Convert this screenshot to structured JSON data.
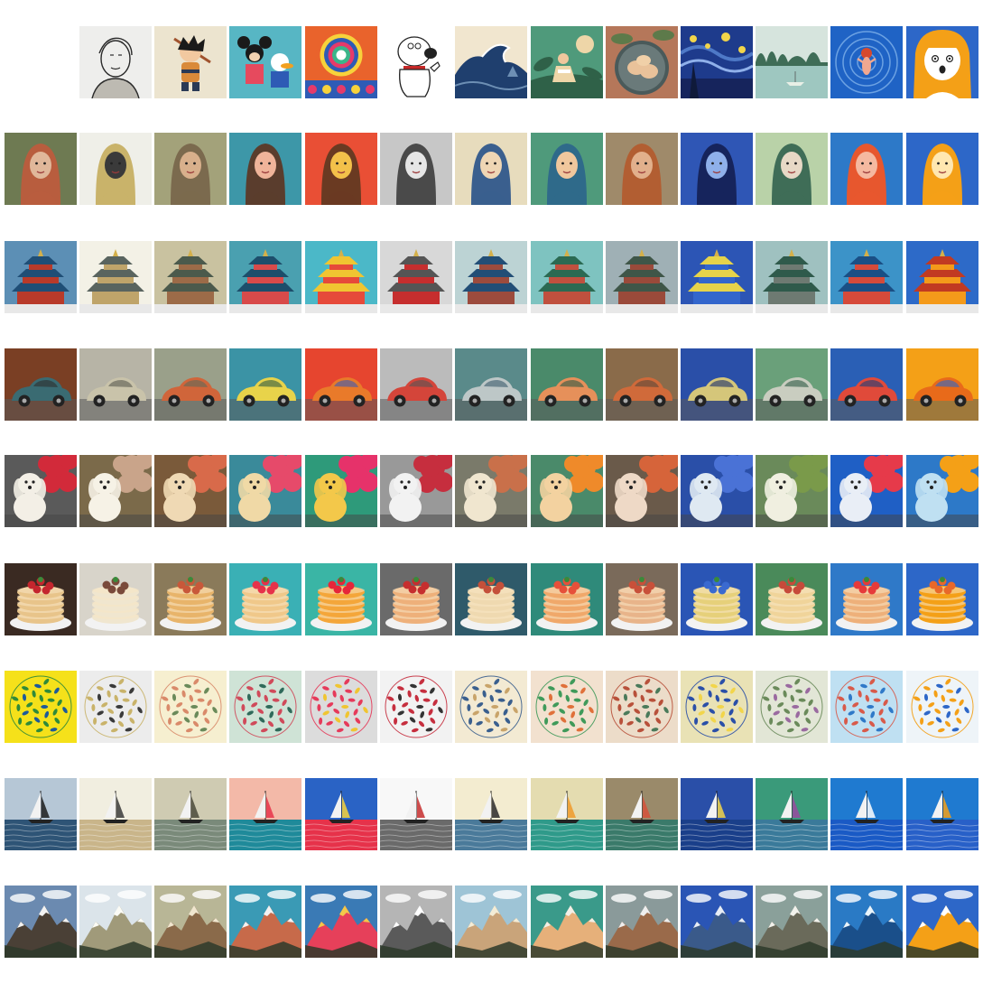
{
  "grid": {
    "style_refs": [
      {
        "name": "pencil-portrait-sketch",
        "bg": "#eeeeec",
        "ink": "#2a2a2a",
        "accent": "#bdbab2"
      },
      {
        "name": "cartoon-monkey-boy",
        "bg": "#ece4cf",
        "ink": "#2b3a55",
        "accent": "#d98a3a"
      },
      {
        "name": "mickey-and-donald-cartoon",
        "bg": "#57b6c4",
        "ink": "#1a1a1a",
        "accent": "#e64a5e"
      },
      {
        "name": "psychedelic-folk-art",
        "bg": "#e9632c",
        "ink": "#2e5bb5",
        "accent": "#f7d23b"
      },
      {
        "name": "cartoon-dog-thumbs-up",
        "bg": "#ffffff",
        "ink": "#222222",
        "accent": "#c62828"
      },
      {
        "name": "great-wave-woodblock",
        "bg": "#f1e6cf",
        "ink": "#1f3f6e",
        "accent": "#6d8fb4"
      },
      {
        "name": "flat-illustration-reader",
        "bg": "#4f9a7b",
        "ink": "#eed6a8",
        "accent": "#2f6148"
      },
      {
        "name": "dumplings-painting",
        "bg": "#b5775a",
        "ink": "#e9c29a",
        "accent": "#5d7a4a"
      },
      {
        "name": "starry-night-painting",
        "bg": "#1e3b8c",
        "ink": "#f2d54a",
        "accent": "#4e79c7"
      },
      {
        "name": "lake-watercolor",
        "bg": "#9ec7c0",
        "ink": "#3f6d57",
        "accent": "#e8efe6"
      },
      {
        "name": "swimmer-blue-water",
        "bg": "#1f63c5",
        "ink": "#d6492e",
        "accent": "#7fb1ea"
      },
      {
        "name": "orange-hair-cartoon-girl",
        "bg": "#2d67c8",
        "ink": "#f4a017",
        "accent": "#ffffff"
      }
    ],
    "rows": [
      {
        "name": "portrait-woman",
        "subject": "portrait",
        "content": {
          "bg": "#6e7a52",
          "main": "#b85d3e",
          "detail": "#e0b79a"
        },
        "styled": [
          {
            "bg": "#efefe8",
            "main": "#c9b36a",
            "detail": "#3a3a3a"
          },
          {
            "bg": "#a3a27a",
            "main": "#7b6a4e",
            "detail": "#d8b08c"
          },
          {
            "bg": "#3d97a8",
            "main": "#5a3d2d",
            "detail": "#f0b49a"
          },
          {
            "bg": "#e94f35",
            "main": "#6a3a22",
            "detail": "#f3c14a"
          },
          {
            "bg": "#c7c7c7",
            "main": "#4a4a4a",
            "detail": "#e6e6e6"
          },
          {
            "bg": "#e7dcbd",
            "main": "#3a5f8e",
            "detail": "#efd6b4"
          },
          {
            "bg": "#4f9a7b",
            "main": "#2f6a8a",
            "detail": "#f0c79d"
          },
          {
            "bg": "#9f8a6a",
            "main": "#b25e32",
            "detail": "#e2b08c"
          },
          {
            "bg": "#2f56b5",
            "main": "#16245c",
            "detail": "#8fb0ea"
          },
          {
            "bg": "#b9d2a8",
            "main": "#3f6d57",
            "detail": "#e7d9c6"
          },
          {
            "bg": "#2d79c8",
            "main": "#e7572e",
            "detail": "#f5b9a0"
          },
          {
            "bg": "#2d67c8",
            "main": "#f4a017",
            "detail": "#ffe7b0"
          }
        ]
      },
      {
        "name": "temple-of-heaven",
        "subject": "temple",
        "content": {
          "bg": "#5c8fb5",
          "main": "#b83a2a",
          "detail": "#1f4e76"
        },
        "styled": [
          {
            "bg": "#f3f1e6",
            "main": "#bfa46a",
            "detail": "#59645f"
          },
          {
            "bg": "#c9c2a0",
            "main": "#9c6b48",
            "detail": "#4b5a4c"
          },
          {
            "bg": "#4aa0b0",
            "main": "#d84a4a",
            "detail": "#1d4e6b"
          },
          {
            "bg": "#4bb8c8",
            "main": "#e64a3a",
            "detail": "#f0c531"
          },
          {
            "bg": "#d8d8d8",
            "main": "#c62e2e",
            "detail": "#555555"
          },
          {
            "bg": "#bcd3d4",
            "main": "#9c4b3d",
            "detail": "#224e76"
          },
          {
            "bg": "#7ec3c0",
            "main": "#c0503e",
            "detail": "#2b6a52"
          },
          {
            "bg": "#9fb0b5",
            "main": "#9a4a3a",
            "detail": "#3f5648"
          },
          {
            "bg": "#2c55b5",
            "main": "#3366cc",
            "detail": "#e6d34a"
          },
          {
            "bg": "#9fc1c0",
            "main": "#6e7a72",
            "detail": "#2f5a4b"
          },
          {
            "bg": "#3c93c8",
            "main": "#d64a3a",
            "detail": "#1a4f85"
          },
          {
            "bg": "#2d6ac8",
            "main": "#f49a1a",
            "detail": "#c13a22"
          }
        ]
      },
      {
        "name": "vintage-car",
        "subject": "car",
        "content": {
          "bg": "#7a3f24",
          "main": "#3a6b72",
          "detail": "#2d2d2d"
        },
        "styled": [
          {
            "bg": "#b7b4a6",
            "main": "#c9c3aa",
            "detail": "#5a5a50"
          },
          {
            "bg": "#9aa08a",
            "main": "#d0653a",
            "detail": "#5f6b5a"
          },
          {
            "bg": "#3b93a5",
            "main": "#e8d34a",
            "detail": "#2e5b44"
          },
          {
            "bg": "#e6452f",
            "main": "#e97a2a",
            "detail": "#3c5ab5"
          },
          {
            "bg": "#bbbbbb",
            "main": "#d4453a",
            "detail": "#555555"
          },
          {
            "bg": "#5a8a8a",
            "main": "#bdc7c7",
            "detail": "#3a5a6a"
          },
          {
            "bg": "#4a8a6a",
            "main": "#e6905a",
            "detail": "#2e5a44"
          },
          {
            "bg": "#8a6b4a",
            "main": "#d06a3a",
            "detail": "#5a4a3a"
          },
          {
            "bg": "#2a4fa8",
            "main": "#d5c67a",
            "detail": "#1a2f6a"
          },
          {
            "bg": "#6aa07a",
            "main": "#c9cdc0",
            "detail": "#2e5a44"
          },
          {
            "bg": "#2a5fb5",
            "main": "#e04a3a",
            "detail": "#1a3f7a"
          },
          {
            "bg": "#f4a017",
            "main": "#e86a1a",
            "detail": "#2d67c8"
          }
        ]
      },
      {
        "name": "spaniel-with-flowers",
        "subject": "dog",
        "content": {
          "bg": "#5a5a5a",
          "main": "#f3efe6",
          "detail": "#d22a3a"
        },
        "styled": [
          {
            "bg": "#7b6a4a",
            "main": "#f6f2e6",
            "detail": "#c9a48a"
          },
          {
            "bg": "#7a5a3a",
            "main": "#efd9b4",
            "detail": "#d86a4a"
          },
          {
            "bg": "#3a8a9a",
            "main": "#f0d9a6",
            "detail": "#e64a6a"
          },
          {
            "bg": "#2e9a7a",
            "main": "#f3c84a",
            "detail": "#e6326a"
          },
          {
            "bg": "#999999",
            "main": "#f2f2f2",
            "detail": "#c62e3e"
          },
          {
            "bg": "#7a7a6a",
            "main": "#f0e6cf",
            "detail": "#c9704a"
          },
          {
            "bg": "#4a8a6a",
            "main": "#f3d2a0",
            "detail": "#ef8a2a"
          },
          {
            "bg": "#6a5a4a",
            "main": "#eed9c6",
            "detail": "#d6643a"
          },
          {
            "bg": "#2a4fa8",
            "main": "#dfe9f2",
            "detail": "#4a72d6"
          },
          {
            "bg": "#6a8a5a",
            "main": "#f0efe0",
            "detail": "#7a9a4a"
          },
          {
            "bg": "#1f5fc5",
            "main": "#e9eef6",
            "detail": "#e63a4a"
          },
          {
            "bg": "#2d79c8",
            "main": "#bfe0f2",
            "detail": "#f4a017"
          }
        ]
      },
      {
        "name": "strawberry-pancakes",
        "subject": "pancakes",
        "content": {
          "bg": "#3a2a22",
          "main": "#e8c48a",
          "detail": "#c4262e"
        },
        "styled": [
          {
            "bg": "#d8d4ca",
            "main": "#f0e6cf",
            "detail": "#7a4a3a"
          },
          {
            "bg": "#8a7a5a",
            "main": "#e8b46a",
            "detail": "#c8583a"
          },
          {
            "bg": "#3ab0b5",
            "main": "#f0c88a",
            "detail": "#e6324a"
          },
          {
            "bg": "#3ab5a5",
            "main": "#f4a63a",
            "detail": "#e6263a"
          },
          {
            "bg": "#6a6a6a",
            "main": "#eeb07a",
            "detail": "#c62e2e"
          },
          {
            "bg": "#2f5a6a",
            "main": "#efd9b0",
            "detail": "#c4503a"
          },
          {
            "bg": "#2f8a7a",
            "main": "#f0a86a",
            "detail": "#e6503a"
          },
          {
            "bg": "#7a6a5a",
            "main": "#e8b48a",
            "detail": "#c8503a"
          },
          {
            "bg": "#2a55b5",
            "main": "#e6d07a",
            "detail": "#3a6ad0"
          },
          {
            "bg": "#4a8a5a",
            "main": "#f0d49a",
            "detail": "#c64a3a"
          },
          {
            "bg": "#2f79c8",
            "main": "#eeb07a",
            "detail": "#e63a3a"
          },
          {
            "bg": "#2d67c8",
            "main": "#f4a017",
            "detail": "#e8682a"
          }
        ]
      },
      {
        "name": "floral-circle-pattern",
        "subject": "pattern",
        "content": {
          "bg": "#f5e11a",
          "main": "#2f8a3a",
          "detail": "#1d5a9a"
        },
        "styled": [
          {
            "bg": "#ececec",
            "main": "#c9b36a",
            "detail": "#3a3a3a"
          },
          {
            "bg": "#f6efd0",
            "main": "#d98a6a",
            "detail": "#6a8a5a"
          },
          {
            "bg": "#cfe3d6",
            "main": "#d04a5a",
            "detail": "#2f6a5a"
          },
          {
            "bg": "#dcdcdc",
            "main": "#e63a5a",
            "detail": "#f0c531"
          },
          {
            "bg": "#f2f2f2",
            "main": "#c62e3e",
            "detail": "#333333"
          },
          {
            "bg": "#f3ead3",
            "main": "#3a5f8e",
            "detail": "#c9a46a"
          },
          {
            "bg": "#f2e1cf",
            "main": "#3f9a5a",
            "detail": "#e0703a"
          },
          {
            "bg": "#ecdcc9",
            "main": "#b8503a",
            "detail": "#4a7a5a"
          },
          {
            "bg": "#e9e2b5",
            "main": "#2a4fa8",
            "detail": "#f2d54a"
          },
          {
            "bg": "#e2e6d6",
            "main": "#6a8a5a",
            "detail": "#9a6aa0"
          },
          {
            "bg": "#bfe0f2",
            "main": "#d85a4a",
            "detail": "#2f79c8"
          },
          {
            "bg": "#eef4f8",
            "main": "#f4a017",
            "detail": "#2d67c8"
          }
        ]
      },
      {
        "name": "sailboat-sea",
        "subject": "sailboat",
        "content": {
          "bg": "#b6c7d6",
          "main": "#2e5476",
          "detail": "#1c1c1c"
        },
        "styled": [
          {
            "bg": "#f1eee0",
            "main": "#c9b58a",
            "detail": "#3a3a3a"
          },
          {
            "bg": "#cfcbb2",
            "main": "#7a8a7a",
            "detail": "#4a4a3a"
          },
          {
            "bg": "#f3b9a8",
            "main": "#1f8a9a",
            "detail": "#e6324a"
          },
          {
            "bg": "#2a63c5",
            "main": "#e6324a",
            "detail": "#f7d23b"
          },
          {
            "bg": "#f8f8f8",
            "main": "#6a6a6a",
            "detail": "#c62e2e"
          },
          {
            "bg": "#f3ecd0",
            "main": "#4a7a9a",
            "detail": "#2a2a2a"
          },
          {
            "bg": "#e4dcb0",
            "main": "#2f9a8a",
            "detail": "#f09a2a"
          },
          {
            "bg": "#9a8a6a",
            "main": "#3a7a6a",
            "detail": "#d6503a"
          },
          {
            "bg": "#2a4fa8",
            "main": "#1a3f8a",
            "detail": "#f2d54a"
          },
          {
            "bg": "#3a9a7a",
            "main": "#3a7a9a",
            "detail": "#9a4aa0"
          },
          {
            "bg": "#1f7ad0",
            "main": "#1a5ac5",
            "detail": "#ffffff"
          },
          {
            "bg": "#1f7ad0",
            "main": "#2860c8",
            "detail": "#f4a017"
          }
        ]
      },
      {
        "name": "snowy-mountains",
        "subject": "mountains",
        "content": {
          "bg": "#6b8ab0",
          "main": "#4a4036",
          "detail": "#f2f2f2"
        },
        "styled": [
          {
            "bg": "#dbe4ea",
            "main": "#a09a7a",
            "detail": "#fbfbf6"
          },
          {
            "bg": "#b8b696",
            "main": "#8a6a4a",
            "detail": "#f0e6cf"
          },
          {
            "bg": "#3a9ab5",
            "main": "#c76a4a",
            "detail": "#f2f2f2"
          },
          {
            "bg": "#3a7ab5",
            "main": "#e6405a",
            "detail": "#f3c84a"
          },
          {
            "bg": "#b5b5b5",
            "main": "#5a5a5a",
            "detail": "#ffffff"
          },
          {
            "bg": "#9ec4d6",
            "main": "#c9a47a",
            "detail": "#f3ecd6"
          },
          {
            "bg": "#3a9a8a",
            "main": "#e6b07a",
            "detail": "#f2efe6"
          },
          {
            "bg": "#8a9a9a",
            "main": "#9a6a4a",
            "detail": "#eeeeee"
          },
          {
            "bg": "#2a55b5",
            "main": "#3a5a8a",
            "detail": "#e6ecf5"
          },
          {
            "bg": "#8aa09a",
            "main": "#6a6a5a",
            "detail": "#f2f2ec"
          },
          {
            "bg": "#2a7ac5",
            "main": "#1a4f8a",
            "detail": "#e9f4fb"
          },
          {
            "bg": "#2d67c8",
            "main": "#f4a017",
            "detail": "#ffffff"
          }
        ]
      }
    ]
  }
}
